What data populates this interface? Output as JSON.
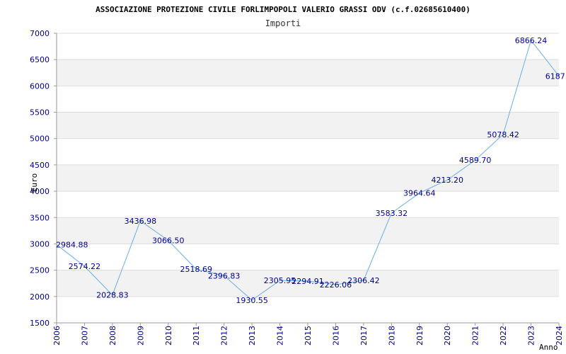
{
  "chart_data": {
    "type": "line",
    "title": "ASSOCIAZIONE PROTEZIONE CIVILE FORLIMPOPOLI VALERIO GRASSI ODV (c.f.02685610400)",
    "subtitle": "Importi",
    "xlabel": "Anno",
    "ylabel": "Euro",
    "ylim": [
      1500,
      7000
    ],
    "yticks": [
      1500,
      2000,
      2500,
      3000,
      3500,
      4000,
      4500,
      5000,
      5500,
      6000,
      6500,
      7000
    ],
    "grid": true,
    "categories": [
      "2006",
      "2007",
      "2008",
      "2009",
      "2010",
      "2011",
      "2012",
      "2013",
      "2014",
      "2015",
      "2016",
      "2017",
      "2018",
      "2019",
      "2020",
      "2021",
      "2022",
      "2023",
      "2024"
    ],
    "values": [
      2984.88,
      2574.22,
      2028.83,
      3436.98,
      3066.5,
      2518.69,
      2396.83,
      1930.55,
      2305.95,
      2294.91,
      2226.06,
      2306.42,
      3583.32,
      3964.64,
      4213.2,
      4589.7,
      5078.42,
      6866.24,
      6187.0
    ],
    "labels": [
      "2984.88",
      "2574.22",
      "2028.83",
      "3436.98",
      "3066.50",
      "2518.69",
      "2396.83",
      "1930.55",
      "2305.95",
      "2294.91",
      "2226.06",
      "2306.42",
      "3583.32",
      "3964.64",
      "4213.20",
      "4589.70",
      "5078.42",
      "6866.24",
      "6187.0"
    ],
    "colors": {
      "line": "#6aaee8",
      "band": "#f2f2f2",
      "grid": "#dddddd",
      "axis": "#9a9a9a",
      "text": "#00008b"
    }
  }
}
